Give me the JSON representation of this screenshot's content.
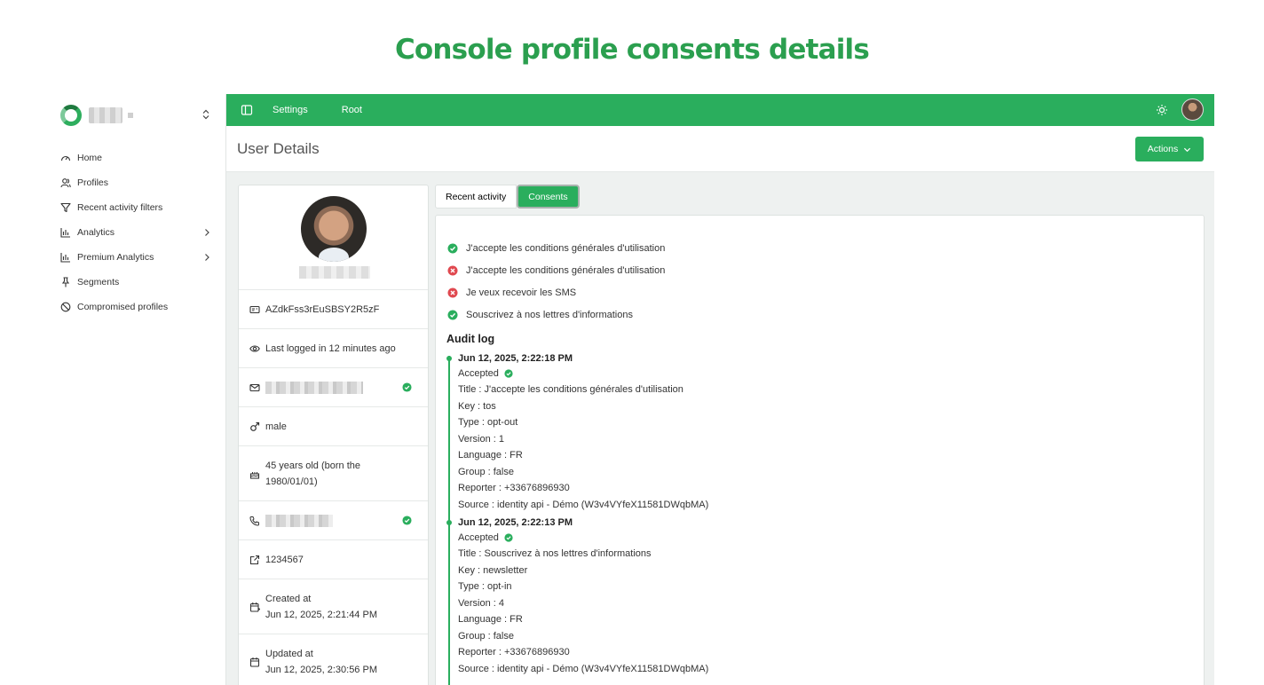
{
  "banner": {
    "title": "Console profile consents details"
  },
  "colors": {
    "brand": "#2aae5d",
    "danger": "#e0484f",
    "title": "#2b9f4f"
  },
  "sidebar": {
    "items": [
      {
        "label": "Home",
        "icon": "gauge-icon"
      },
      {
        "label": "Profiles",
        "icon": "users-icon"
      },
      {
        "label": "Recent activity filters",
        "icon": "filter-icon"
      },
      {
        "label": "Analytics",
        "icon": "bar-chart-icon",
        "expandable": true
      },
      {
        "label": "Premium Analytics",
        "icon": "bar-chart-icon",
        "expandable": true
      },
      {
        "label": "Segments",
        "icon": "pin-icon"
      },
      {
        "label": "Compromised profiles",
        "icon": "ban-icon"
      }
    ]
  },
  "topbar": {
    "crumbs": [
      "Settings",
      "Root"
    ]
  },
  "header": {
    "title": "User Details",
    "actions_label": "Actions"
  },
  "profile": {
    "id": "AZdkFss3rEuSBSY2R5zF",
    "last_login": "Last logged in 12 minutes ago",
    "gender": "male",
    "age_line1": "45 years old (born the",
    "age_line2": "1980/01/01)",
    "external_id": "1234567",
    "created_label": "Created at",
    "created_value": "Jun 12, 2025, 2:21:44 PM",
    "updated_label": "Updated at",
    "updated_value": "Jun 12, 2025, 2:30:56 PM"
  },
  "tabs": [
    {
      "label": "Recent activity"
    },
    {
      "label": "Consents"
    }
  ],
  "consents": [
    {
      "label": "J'accepte les conditions générales d'utilisation",
      "status": "accepted"
    },
    {
      "label": "J'accepte les conditions générales d'utilisation",
      "status": "refused"
    },
    {
      "label": "Je veux recevoir les SMS",
      "status": "refused"
    },
    {
      "label": "Souscrivez à nos lettres d'informations",
      "status": "accepted"
    }
  ],
  "audit": {
    "title": "Audit log",
    "entries": [
      {
        "date": "Jun 12, 2025, 2:22:18 PM",
        "status": "Accepted",
        "lines": [
          "Title : J'accepte les conditions générales d'utilisation",
          "Key : tos",
          "Type : opt-out",
          "Version : 1",
          "Language : FR",
          "Group : false",
          "Reporter : +33676896930",
          "Source : identity api - Démo (W3v4VYfeX11581DWqbMA)"
        ]
      },
      {
        "date": "Jun 12, 2025, 2:22:13 PM",
        "status": "Accepted",
        "lines": [
          "Title : Souscrivez à nos lettres d'informations",
          "Key : newsletter",
          "Type : opt-in",
          "Version : 4",
          "Language : FR",
          "Group : false",
          "Reporter : +33676896930",
          "Source : identity api - Démo (W3v4VYfeX11581DWqbMA)"
        ]
      }
    ]
  }
}
